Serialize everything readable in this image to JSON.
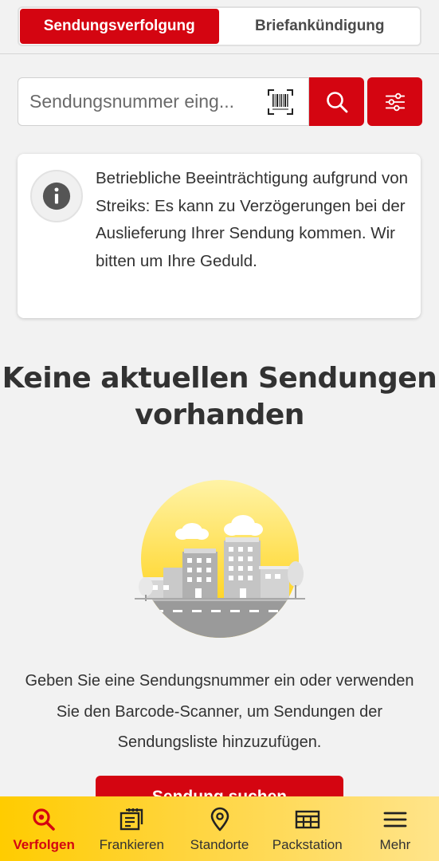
{
  "header": {
    "tabs": [
      {
        "label": "Sendungsverfolgung",
        "active": true
      },
      {
        "label": "Briefankündigung",
        "active": false
      }
    ]
  },
  "search": {
    "placeholder": "Sendungsnummer eing...",
    "barcode_icon": "barcode-scanner-icon",
    "search_icon": "search-icon",
    "filter_icon": "filter-sliders-icon"
  },
  "notice": {
    "icon": "info-icon",
    "text": "Betriebliche Beeinträchtigung aufgrund von Streiks: Es kann zu Verzögerungen bei der Auslieferung Ihrer Sendung kommen. Wir bitten um Ihre Geduld."
  },
  "empty_state": {
    "title": "Keine aktuellen Sendungen vorhanden",
    "description": "Geben Sie eine Sendungsnummer ein oder verwenden Sie den Barcode-Scanner, um Sendungen der Sendungsliste hinzuzufügen.",
    "cta_label": "Sendung suchen",
    "illustration": "city-illustration"
  },
  "tabbar": {
    "items": [
      {
        "label": "Verfolgen",
        "icon": "track-search-icon",
        "active": true
      },
      {
        "label": "Frankieren",
        "icon": "stamp-icon",
        "active": false
      },
      {
        "label": "Standorte",
        "icon": "location-pin-icon",
        "active": false
      },
      {
        "label": "Packstation",
        "icon": "packstation-icon",
        "active": false
      },
      {
        "label": "Mehr",
        "icon": "menu-icon",
        "active": false
      }
    ]
  },
  "colors": {
    "brand_red": "#d40511",
    "brand_yellow": "#ffcc00",
    "background": "#f2f2f2",
    "text": "#323232"
  }
}
